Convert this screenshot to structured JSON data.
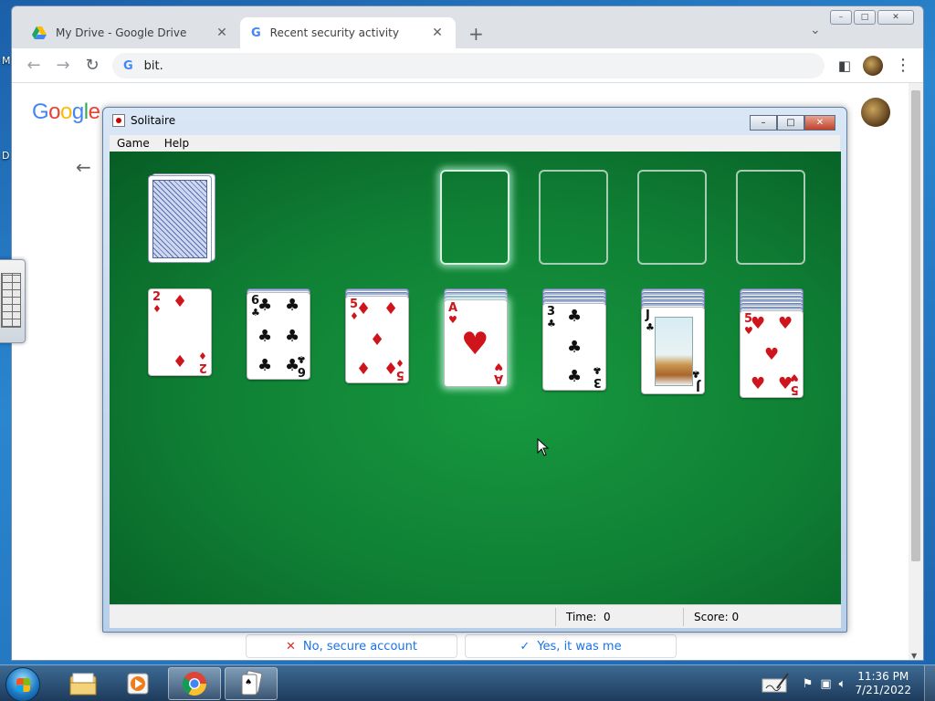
{
  "desktop": {
    "labels": [
      "M",
      "D"
    ]
  },
  "chrome": {
    "tabs": [
      {
        "title": "My Drive - Google Drive",
        "icon": "google-drive-icon"
      },
      {
        "title": "Recent security activity",
        "icon": "google-g-icon",
        "active": true
      }
    ],
    "new_tab": "+",
    "tab_menu": "⌄",
    "omnibox": {
      "value": "bit.",
      "icon": "google-g-icon"
    },
    "window_buttons": [
      "–",
      "□",
      "✕"
    ]
  },
  "page": {
    "logo": "Google",
    "buttons": [
      {
        "label": "No, secure account",
        "icon": "✕"
      },
      {
        "label": "Yes, it was me",
        "icon": "✓"
      }
    ]
  },
  "solitaire": {
    "title": "Solitaire",
    "menu": [
      "Game",
      "Help"
    ],
    "status": {
      "time_label": "Time:",
      "time_value": "0",
      "score_label": "Score: 0"
    },
    "tableau": [
      {
        "rank": "2",
        "suit": "♦",
        "color": "red",
        "hidden": 0
      },
      {
        "rank": "6",
        "suit": "♣",
        "color": "black",
        "hidden": 1
      },
      {
        "rank": "5",
        "suit": "♦",
        "color": "red",
        "hidden": 2
      },
      {
        "rank": "A",
        "suit": "♥",
        "color": "red",
        "hidden": 3,
        "highlighted": true
      },
      {
        "rank": "3",
        "suit": "♣",
        "color": "black",
        "hidden": 4
      },
      {
        "rank": "J",
        "suit": "♣",
        "color": "black",
        "hidden": 5
      },
      {
        "rank": "5",
        "suit": "♥",
        "color": "red",
        "hidden": 6
      }
    ]
  },
  "taskbar": {
    "items": [
      "windows-explorer-icon",
      "media-player-icon",
      "chrome-icon",
      "solitaire-icon"
    ],
    "clock": {
      "time": "11:36 PM",
      "date": "7/21/2022"
    }
  }
}
